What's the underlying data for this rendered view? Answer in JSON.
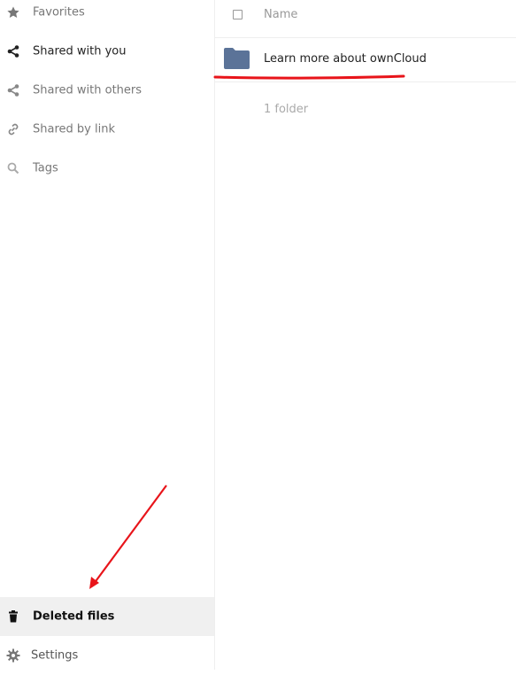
{
  "sidebar": {
    "items": [
      {
        "label": "Favorites",
        "icon": "star-icon"
      },
      {
        "label": "Shared with you",
        "icon": "share-icon"
      },
      {
        "label": "Shared with others",
        "icon": "share-icon"
      },
      {
        "label": "Shared by link",
        "icon": "link-icon"
      },
      {
        "label": "Tags",
        "icon": "search-icon"
      }
    ],
    "deleted_files": {
      "label": "Deleted files",
      "icon": "trash-icon"
    },
    "settings": {
      "label": "Settings",
      "icon": "gear-icon"
    }
  },
  "file_list": {
    "column_name": "Name",
    "rows": [
      {
        "name": "Learn more about ownCloud",
        "type": "folder"
      }
    ],
    "summary": "1 folder"
  },
  "colors": {
    "folder": "#5b7398",
    "annotation": "#e8141a",
    "active_bg": "#f0f0f0"
  }
}
